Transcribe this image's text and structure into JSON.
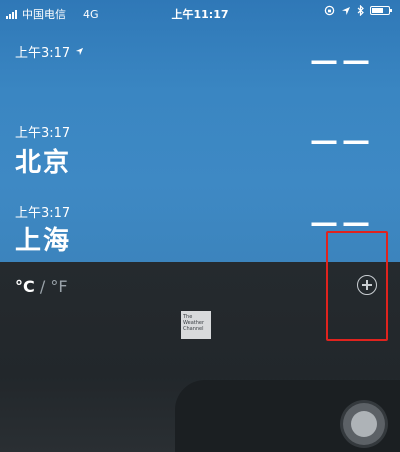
{
  "status_bar": {
    "carrier": "中国电信",
    "network": "4G",
    "time": "上午11:17",
    "battery_level": 0.8
  },
  "cities": [
    {
      "time": "上午3:17",
      "name": "",
      "temperature": "——",
      "has_location_icon": true
    },
    {
      "time": "上午3:17",
      "name": "北京",
      "temperature": "——",
      "has_location_icon": false
    },
    {
      "time": "上午3:17",
      "name": "上海",
      "temperature": "——",
      "has_location_icon": false
    }
  ],
  "units": {
    "celsius": "°C",
    "separator": "/",
    "fahrenheit": "°F"
  },
  "logo": {
    "text": "The Weather Channel"
  },
  "icons": {
    "add": "plus-circle-icon",
    "location": "location-arrow-icon",
    "home": "home-button-icon"
  },
  "colors": {
    "sky": "#3a86c2",
    "panel": "#22272b",
    "highlight": "#e0231e"
  }
}
